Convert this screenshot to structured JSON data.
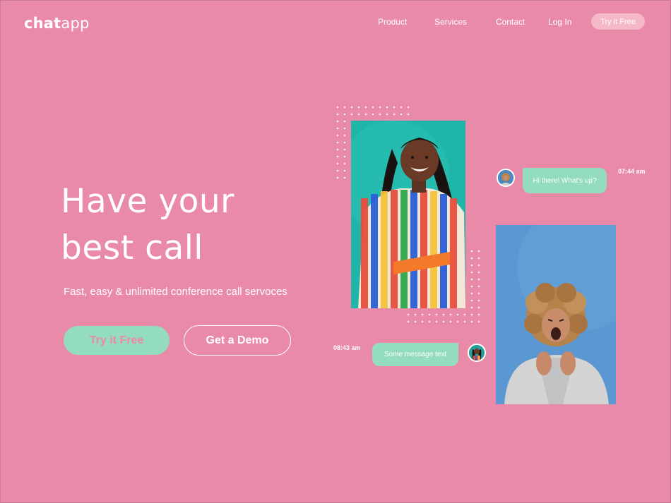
{
  "brand": {
    "logo_bold": "chat",
    "logo_light": "app"
  },
  "nav": {
    "items": [
      "Product",
      "Services",
      "Contact",
      "Log In"
    ],
    "cta": "Try it Free"
  },
  "hero": {
    "title_line1": "Have your",
    "title_line2": "best call",
    "subtitle": "Fast, easy & unlimited conference call servoces",
    "primary_button": "Try it Free",
    "secondary_button": "Get a Demo"
  },
  "chat": {
    "message_1": {
      "text": "Hi there! What's up?",
      "time": "07:44 am"
    },
    "message_2": {
      "text": "Some message text",
      "time": "08:43 am"
    }
  },
  "colors": {
    "background": "#e98aa8",
    "accent_mint": "#93dcc0",
    "nav_cta_bg": "#f4b8c8",
    "text": "#ffffff"
  }
}
